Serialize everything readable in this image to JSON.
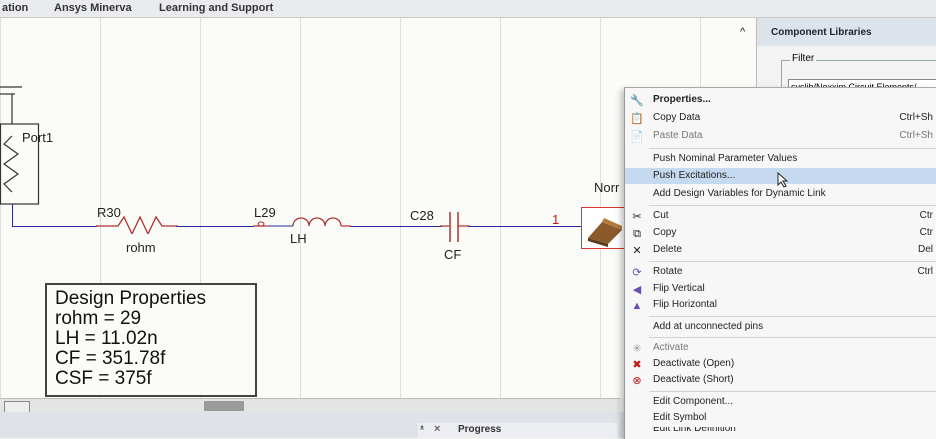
{
  "menubar": {
    "items": [
      "ation",
      "Ansys Minerva",
      "Learning and Support"
    ]
  },
  "schematic": {
    "port_label": "Port1",
    "r30": {
      "name": "R30",
      "param": "rohm"
    },
    "l29": {
      "name": "L29",
      "param": "LH"
    },
    "c28": {
      "name": "C28",
      "param": "CF"
    },
    "pin_number": "1",
    "partial_label": "Norr"
  },
  "design_properties": {
    "title": "Design Properties",
    "lines": [
      "rohm = 29",
      "LH = 11.02n",
      "CF = 351.78f",
      "CSF = 375f"
    ]
  },
  "panel": {
    "title": "Component Libraries",
    "filter_label": "Filter",
    "filter_value": "syslib/Nexxim Circuit Elements/",
    "collapse_glyph": "^"
  },
  "status": {
    "progress_label": "Progress",
    "pin_glyph": "ᵜ",
    "close_glyph": "×"
  },
  "context_menu": {
    "properties": "Properties...",
    "copy_data": "Copy Data",
    "copy_data_shortcut": "Ctrl+Sh",
    "paste_data": "Paste Data",
    "paste_data_shortcut": "Ctrl+Sh",
    "push_nominal": "Push Nominal Parameter Values",
    "push_excitations": "Push Excitations...",
    "add_design_vars": "Add Design Variables for Dynamic Link",
    "cut": "Cut",
    "cut_shortcut": "Ctr",
    "copy": "Copy",
    "copy_shortcut": "Ctr",
    "delete": "Delete",
    "delete_shortcut": "Del",
    "rotate": "Rotate",
    "rotate_shortcut": "Ctrl",
    "flip_vertical": "Flip Vertical",
    "flip_horizontal": "Flip Horizontal",
    "add_unconnected": "Add at unconnected pins",
    "activate": "Activate",
    "deactivate_open": "Deactivate (Open)",
    "deactivate_short": "Deactivate (Short)",
    "edit_component": "Edit Component...",
    "edit_symbol": "Edit Symbol",
    "edit_link_def": "Edit Link Definition"
  },
  "colors": {
    "wire": "#2a2aa0",
    "component": "#b03030",
    "highlight": "#c5d9f1",
    "pin": "#d01010"
  }
}
